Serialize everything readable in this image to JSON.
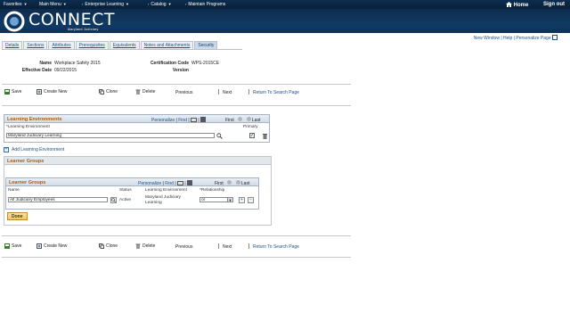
{
  "nav": {
    "favorites": "Favorites",
    "main_menu": "Main Menu",
    "breadcrumb_1": "Enterprise Learning",
    "breadcrumb_2": "Catalog",
    "breadcrumb_3": "Maintain Programs",
    "home": "Home",
    "sign_out": "Sign out"
  },
  "brand": {
    "name": "CONNECT",
    "subtitle": "Maryland Judiciary"
  },
  "page_links": {
    "new_window": "New Window",
    "help": "Help",
    "personalize_page": "Personalize Page"
  },
  "tabs": [
    {
      "label": "Details"
    },
    {
      "label": "Sections"
    },
    {
      "label": "Attributes"
    },
    {
      "label": "Prerequisites"
    },
    {
      "label": "Equivalents"
    },
    {
      "label": "Notes and Attachments"
    },
    {
      "label": "Security"
    }
  ],
  "header": {
    "name_label": "Name",
    "name_value": "Workplace Safety 2015",
    "effective_date_label": "Effective Date",
    "effective_date_value": "09/22/2015",
    "cert_code_label": "Certification Code",
    "cert_code_value": "WPS-2015CE",
    "version_label": "Version",
    "version_value": ""
  },
  "toolbar": {
    "save": "Save",
    "create_new": "Create New",
    "clone": "Clone",
    "delete": "Delete",
    "previous": "Previous",
    "next": "Next",
    "return_search": "Return To Search Page"
  },
  "learning_env": {
    "title": "Learning Environments",
    "personalize": "Personalize",
    "find": "Find",
    "first": "First",
    "last": "Last",
    "col_env": "*Learning Environment",
    "col_primary": "Primary",
    "row_value": "Maryland Judiciary Learning",
    "add_link": "Add Learning Environment"
  },
  "learner_groups_box": {
    "title": "Learner Groups"
  },
  "learner_groups_grid": {
    "title": "Learner Groups",
    "personalize": "Personalize",
    "find": "Find",
    "first": "First",
    "last": "Last",
    "col_name": "Name",
    "col_status": "Status",
    "col_env": "Learning Environment",
    "col_rel": "*Relationship",
    "row_name": "All Judiciary Employees",
    "row_status": "Active",
    "row_env_line1": "Maryland Judiciary",
    "row_env_line2": "Learning",
    "row_rel": "or"
  },
  "done_button": "Done"
}
